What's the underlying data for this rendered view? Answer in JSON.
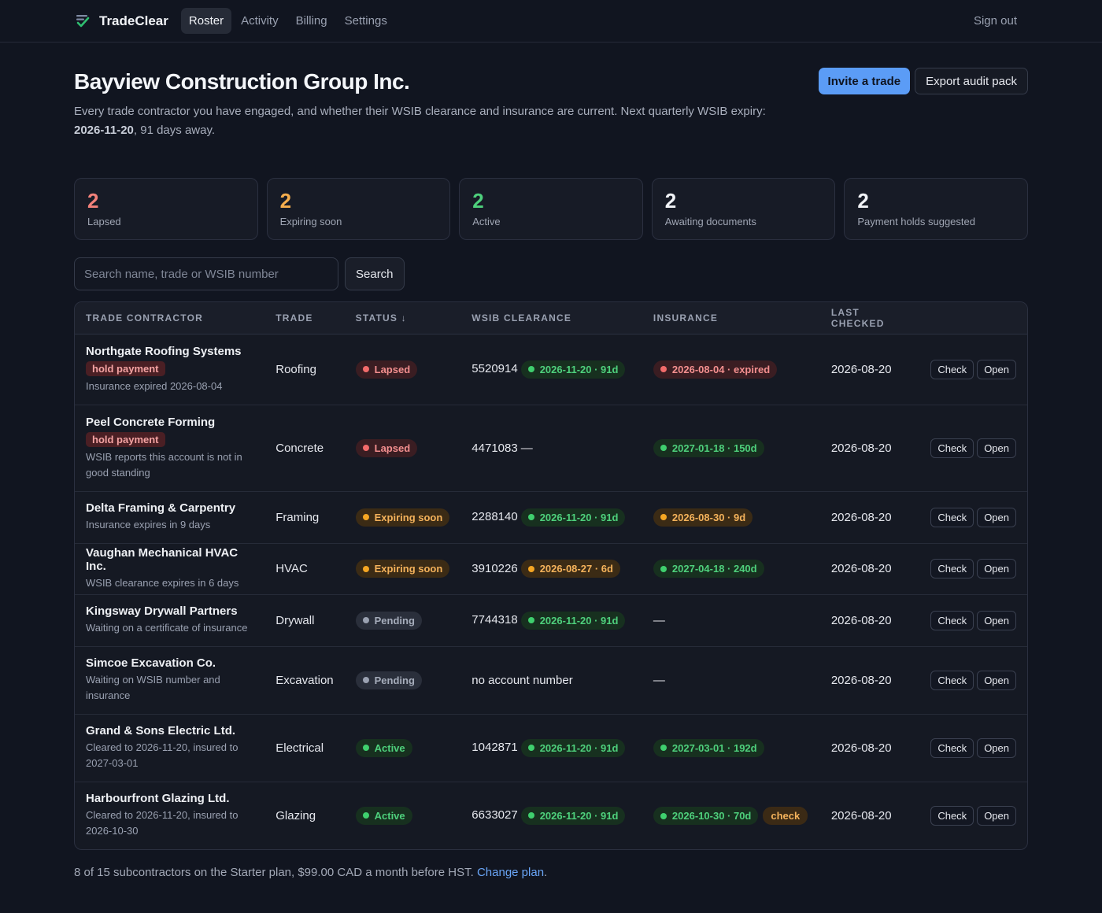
{
  "nav": {
    "brand": "TradeClear",
    "tabs": [
      "Roster",
      "Activity",
      "Billing",
      "Settings"
    ],
    "active_tab": "Roster",
    "sign_out": "Sign out",
    "brand_color": "#2fbf71"
  },
  "header": {
    "title": "Bayview Construction Group Inc.",
    "subtitle_prefix": "Every trade contractor you have engaged, and whether their WSIB clearance and insurance are current. Next quarterly WSIB expiry: ",
    "subtitle_date": "2026-11-20",
    "subtitle_suffix": ", 91 days away.",
    "invite_label": "Invite a trade",
    "export_label": "Export audit pack"
  },
  "stats": [
    {
      "value": "2",
      "label": "Lapsed",
      "color": "#f2817a"
    },
    {
      "value": "2",
      "label": "Expiring soon",
      "color": "#f5ad4d"
    },
    {
      "value": "2",
      "label": "Active",
      "color": "#4ed07c"
    },
    {
      "value": "2",
      "label": "Awaiting documents",
      "color": "#f1f3f7"
    },
    {
      "value": "2",
      "label": "Payment holds suggested",
      "color": "#f1f3f7"
    }
  ],
  "search": {
    "placeholder": "Search name, trade or WSIB number",
    "button": "Search"
  },
  "table": {
    "headers": {
      "name": "TRADE CONTRACTOR",
      "trade": "TRADE",
      "status": "STATUS ↓",
      "wsib": "WSIB CLEARANCE",
      "insurance": "INSURANCE",
      "checked": "LAST CHECKED"
    },
    "check_label": "Check",
    "open_label": "Open",
    "rows": [
      {
        "name": "Northgate Roofing Systems",
        "hold": "hold payment",
        "note": "Insurance expired 2026-08-04",
        "trade": "Roofing",
        "status": "Lapsed",
        "status_tone": "red",
        "wsib_number": "5520914",
        "wsib_pill": "2026-11-20 · 91d",
        "wsib_tone": "green",
        "wsib_text": "",
        "ins_pill": "2026-08-04 · expired",
        "ins_tone": "red",
        "ins_text": "",
        "ins_flag": "",
        "checked": "2026-08-20"
      },
      {
        "name": "Peel Concrete Forming",
        "hold": "hold payment",
        "note": "WSIB reports this account is not in good standing",
        "trade": "Concrete",
        "status": "Lapsed",
        "status_tone": "red",
        "wsib_number": "4471083",
        "wsib_pill": "",
        "wsib_tone": "",
        "wsib_text": "—",
        "ins_pill": "2027-01-18 · 150d",
        "ins_tone": "green",
        "ins_text": "",
        "ins_flag": "",
        "checked": "2026-08-20"
      },
      {
        "name": "Delta Framing & Carpentry",
        "hold": "",
        "note": "Insurance expires in 9 days",
        "trade": "Framing",
        "status": "Expiring soon",
        "status_tone": "amber",
        "wsib_number": "2288140",
        "wsib_pill": "2026-11-20 · 91d",
        "wsib_tone": "green",
        "wsib_text": "",
        "ins_pill": "2026-08-30 · 9d",
        "ins_tone": "amber",
        "ins_text": "",
        "ins_flag": "",
        "checked": "2026-08-20"
      },
      {
        "name": "Vaughan Mechanical HVAC Inc.",
        "hold": "",
        "note": "WSIB clearance expires in 6 days",
        "trade": "HVAC",
        "status": "Expiring soon",
        "status_tone": "amber",
        "wsib_number": "3910226",
        "wsib_pill": "2026-08-27 · 6d",
        "wsib_tone": "amber",
        "wsib_text": "",
        "ins_pill": "2027-04-18 · 240d",
        "ins_tone": "green",
        "ins_text": "",
        "ins_flag": "",
        "checked": "2026-08-20"
      },
      {
        "name": "Kingsway Drywall Partners",
        "hold": "",
        "note": "Waiting on a certificate of insurance",
        "trade": "Drywall",
        "status": "Pending",
        "status_tone": "grey",
        "wsib_number": "7744318",
        "wsib_pill": "2026-11-20 · 91d",
        "wsib_tone": "green",
        "wsib_text": "",
        "ins_pill": "",
        "ins_tone": "",
        "ins_text": "—",
        "ins_flag": "",
        "checked": "2026-08-20"
      },
      {
        "name": "Simcoe Excavation Co.",
        "hold": "",
        "note": "Waiting on WSIB number and insurance",
        "trade": "Excavation",
        "status": "Pending",
        "status_tone": "grey",
        "wsib_number": "",
        "wsib_pill": "",
        "wsib_tone": "",
        "wsib_text": "no account number",
        "ins_pill": "",
        "ins_tone": "",
        "ins_text": "—",
        "ins_flag": "",
        "checked": "2026-08-20"
      },
      {
        "name": "Grand & Sons Electric Ltd.",
        "hold": "",
        "note": "Cleared to 2026-11-20, insured to 2027-03-01",
        "trade": "Electrical",
        "status": "Active",
        "status_tone": "green",
        "wsib_number": "1042871",
        "wsib_pill": "2026-11-20 · 91d",
        "wsib_tone": "green",
        "wsib_text": "",
        "ins_pill": "2027-03-01 · 192d",
        "ins_tone": "green",
        "ins_text": "",
        "ins_flag": "",
        "checked": "2026-08-20"
      },
      {
        "name": "Harbourfront Glazing Ltd.",
        "hold": "",
        "note": "Cleared to 2026-11-20, insured to 2026-10-30",
        "trade": "Glazing",
        "status": "Active",
        "status_tone": "green",
        "wsib_number": "6633027",
        "wsib_pill": "2026-11-20 · 91d",
        "wsib_tone": "green",
        "wsib_text": "",
        "ins_pill": "2026-10-30 · 70d",
        "ins_tone": "green",
        "ins_text": "",
        "ins_flag": "check",
        "checked": "2026-08-20"
      }
    ]
  },
  "footer": {
    "text": "8 of 15 subcontractors on the Starter plan, $99.00 CAD a month before HST. ",
    "link": "Change plan",
    "after_link": "."
  }
}
